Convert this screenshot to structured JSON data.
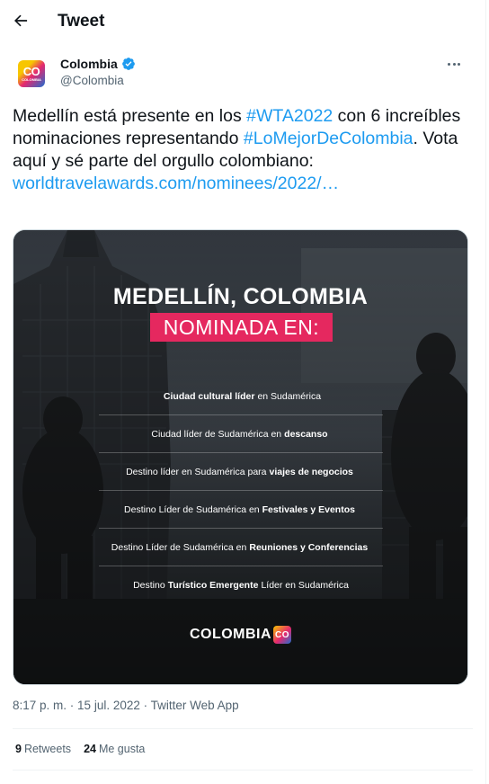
{
  "header": {
    "title": "Tweet",
    "back_icon": "arrow-left-icon"
  },
  "author": {
    "name": "Colombia",
    "handle": "@Colombia",
    "verified_icon": "verified-badge-icon",
    "avatar": {
      "logo_text": "CO",
      "logo_sub": "COLOMBIA"
    },
    "more_icon": "ellipsis-icon"
  },
  "tweet": {
    "text_1": "Medellín está presente en los ",
    "hashtag_1": "#WTA2022",
    "text_2": " con 6 increíbles nominaciones representando ",
    "hashtag_2": "#LoMejorDeColombia",
    "text_3": ". Vota aquí y sé parte del orgullo colombiano: ",
    "link": "worldtravelawards.com/nominees/2022/…"
  },
  "media": {
    "title": "MEDELLÍN, COLOMBIA",
    "badge": "NOMINADA EN:",
    "items": [
      {
        "pre": "",
        "bold": "Ciudad cultural líder",
        "post": "en Sudamérica"
      },
      {
        "pre": "Ciudad líder de Sudamérica en",
        "bold": "descanso",
        "post": ""
      },
      {
        "pre": "Destino líder en Sudamérica para",
        "bold": "viajes de negocios",
        "post": ""
      },
      {
        "pre": "Destino Líder de Sudamérica en",
        "bold": "Festivales y Eventos",
        "post": ""
      },
      {
        "pre": "Destino Líder de Sudamérica en",
        "bold": "Reuniones y Conferencias",
        "post": ""
      },
      {
        "pre": "Destino",
        "bold": "Turístico Emergente",
        "post": "Líder en Sudamérica"
      }
    ],
    "brand": "COLOMBIA",
    "brand_mark": "CO",
    "colors": {
      "badge": "#e5285f",
      "accent_yellow": "#f7c600",
      "accent_blue": "#1c6fd1"
    }
  },
  "meta": {
    "time": "8:17 p. m.",
    "sep": " · ",
    "date": "15 jul. 2022",
    "source": "Twitter Web App"
  },
  "stats": {
    "retweets_count": "9",
    "retweets_label": "Retweets",
    "likes_count": "24",
    "likes_label": "Me gusta"
  },
  "colors": {
    "link": "#1d9bf0",
    "text": "#0f1419",
    "secondary": "#536471"
  }
}
